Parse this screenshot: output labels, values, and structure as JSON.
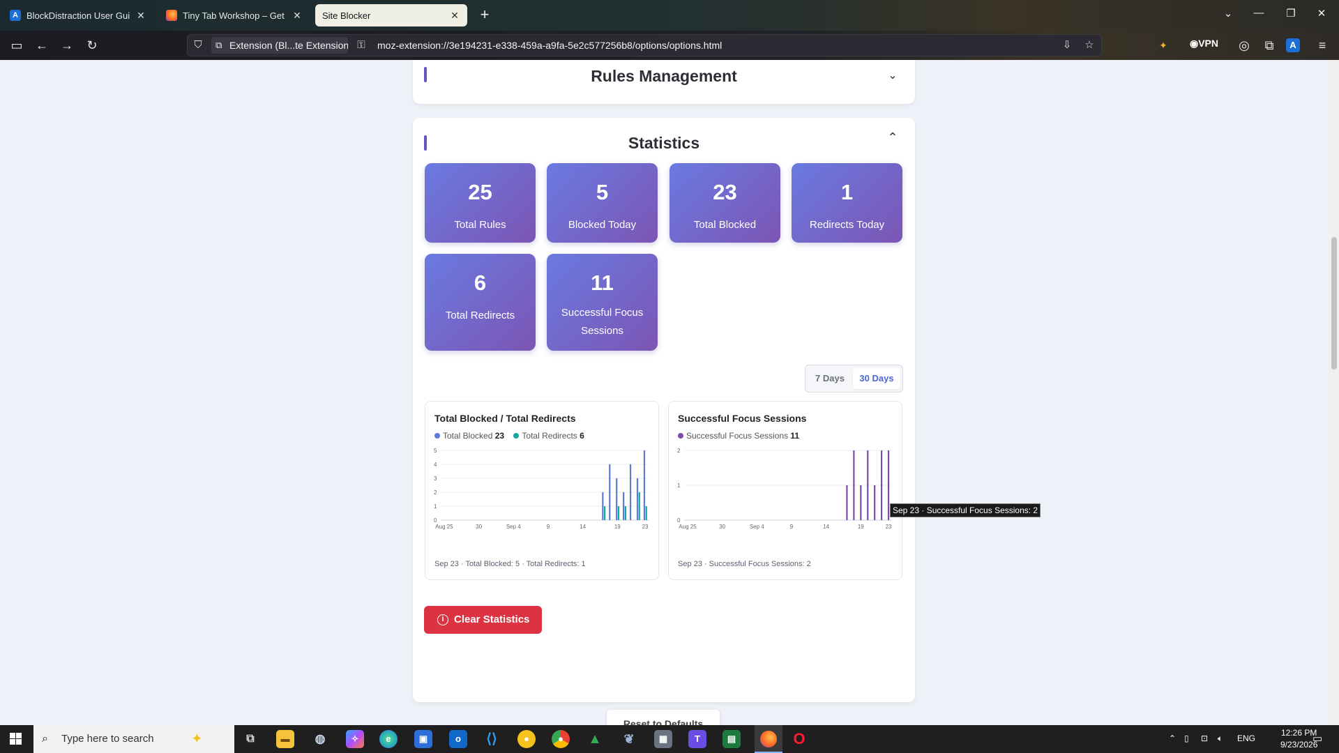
{
  "browser": {
    "tabs": [
      {
        "label": "BlockDistraction User Guide: Ru",
        "favicon": "A"
      },
      {
        "label": "Tiny Tab Workshop – Get this Th",
        "favicon": "firefox"
      },
      {
        "label": "Site Blocker",
        "favicon": ""
      }
    ],
    "identity_label": "Extension (Bl...te Extension)",
    "url": "moz-extension://3e194231-e338-459a-a9fa-5e2c577256b8/options/options.html",
    "vpn_label": "VPN"
  },
  "rules_card": {
    "title": "Rules Management"
  },
  "stats_card": {
    "title": "Statistics",
    "stats": [
      {
        "value": "25",
        "label": "Total Rules"
      },
      {
        "value": "5",
        "label": "Blocked Today"
      },
      {
        "value": "23",
        "label": "Total Blocked"
      },
      {
        "value": "1",
        "label": "Redirects Today"
      },
      {
        "value": "6",
        "label": "Total Redirects"
      },
      {
        "value": "11",
        "label": "Successful Focus Sessions"
      }
    ],
    "range_options": [
      "7 Days",
      "30 Days"
    ],
    "range_selected": "30 Days",
    "clear_label": "Clear Statistics",
    "tooltip": "Sep 23 · Successful Focus Sessions: 2"
  },
  "reset_label": "Reset to Defaults",
  "chart_data": [
    {
      "type": "bar",
      "title": "Total Blocked / Total Redirects",
      "legend_totals": {
        "Total Blocked": "23",
        "Total Redirects": "6"
      },
      "x_tick_labels": [
        "Aug 25",
        "30",
        "Sep 4",
        "9",
        "14",
        "19",
        "23"
      ],
      "x_tick_days": [
        0,
        5,
        10,
        15,
        20,
        25,
        29
      ],
      "ylim": [
        0,
        5
      ],
      "y_ticks": [
        "0",
        "1",
        "2",
        "3",
        "4",
        "5"
      ],
      "days": 30,
      "series": [
        {
          "name": "Total Blocked",
          "color": "#5b7bd6",
          "values": [
            0,
            0,
            0,
            0,
            0,
            0,
            0,
            0,
            0,
            0,
            0,
            0,
            0,
            0,
            0,
            0,
            0,
            0,
            0,
            0,
            0,
            0,
            0,
            2,
            4,
            3,
            2,
            4,
            3,
            5
          ]
        },
        {
          "name": "Total Redirects",
          "color": "#1aa3a3",
          "values": [
            0,
            0,
            0,
            0,
            0,
            0,
            0,
            0,
            0,
            0,
            0,
            0,
            0,
            0,
            0,
            0,
            0,
            0,
            0,
            0,
            0,
            0,
            0,
            1,
            0,
            1,
            1,
            0,
            2,
            1
          ]
        }
      ],
      "summary": "Sep 23 · Total Blocked: 5 · Total Redirects: 1"
    },
    {
      "type": "bar",
      "title": "Successful Focus Sessions",
      "legend_totals": {
        "Successful Focus Sessions": "11"
      },
      "x_tick_labels": [
        "Aug 25",
        "30",
        "Sep 4",
        "9",
        "14",
        "19",
        "23"
      ],
      "x_tick_days": [
        0,
        5,
        10,
        15,
        20,
        25,
        29
      ],
      "ylim": [
        0,
        2
      ],
      "y_ticks": [
        "0",
        "1",
        "2"
      ],
      "days": 30,
      "series": [
        {
          "name": "Successful Focus Sessions",
          "color": "#7a4ea8",
          "values": [
            0,
            0,
            0,
            0,
            0,
            0,
            0,
            0,
            0,
            0,
            0,
            0,
            0,
            0,
            0,
            0,
            0,
            0,
            0,
            0,
            0,
            0,
            0,
            1,
            2,
            1,
            2,
            1,
            2,
            2
          ]
        }
      ],
      "summary": "Sep 23 · Successful Focus Sessions: 2"
    }
  ],
  "taskbar": {
    "search_placeholder": "Type here to search",
    "lang": "ENG",
    "time": "12:26 PM",
    "date": "9/23/2026"
  }
}
